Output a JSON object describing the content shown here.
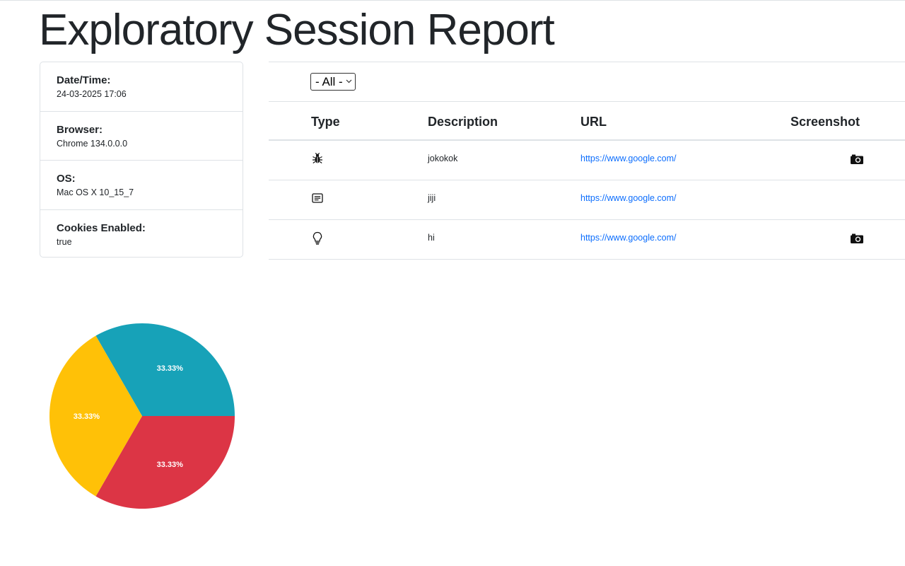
{
  "page": {
    "title": "Exploratory Session Report"
  },
  "session_info": [
    {
      "label": "Date/Time:",
      "value": "24-03-2025 17:06"
    },
    {
      "label": "Browser:",
      "value": "Chrome 134.0.0.0"
    },
    {
      "label": "OS:",
      "value": "Mac OS X 10_15_7"
    },
    {
      "label": "Cookies Enabled:",
      "value": "true"
    }
  ],
  "filter": {
    "selected": "- All -"
  },
  "table": {
    "headers": {
      "type": "Type",
      "description": "Description",
      "url": "URL",
      "screenshot": "Screenshot"
    },
    "rows": [
      {
        "type_icon": "bug-icon",
        "description": "jokokok",
        "url": "https://www.google.com/",
        "has_screenshot": true
      },
      {
        "type_icon": "note-icon",
        "description": "jiji",
        "url": "https://www.google.com/",
        "has_screenshot": false
      },
      {
        "type_icon": "lightbulb-icon",
        "description": "hi",
        "url": "https://www.google.com/",
        "has_screenshot": true
      }
    ]
  },
  "chart_data": {
    "type": "pie",
    "slices": [
      {
        "value": 33.33,
        "label": "33.33%",
        "color": "#17a2b8"
      },
      {
        "value": 33.33,
        "label": "33.33%",
        "color": "#dc3545"
      },
      {
        "value": 33.33,
        "label": "33.33%",
        "color": "#ffc107"
      }
    ]
  }
}
